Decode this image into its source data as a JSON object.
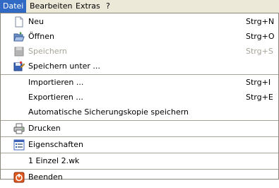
{
  "menubar": {
    "items": [
      {
        "label": "Datei"
      },
      {
        "label": "Bearbeiten"
      },
      {
        "label": "Extras"
      },
      {
        "label": "?"
      }
    ]
  },
  "menu": {
    "items": [
      {
        "label": "Neu",
        "shortcut": "Strg+N",
        "icon": "new-document-icon",
        "enabled": true
      },
      {
        "label": "Öffnen",
        "shortcut": "Strg+O",
        "icon": "open-folder-icon",
        "enabled": true
      },
      {
        "label": "Speichern",
        "shortcut": "Strg+S",
        "icon": "save-icon",
        "enabled": false
      },
      {
        "label": "Speichern unter ...",
        "shortcut": "",
        "icon": "save-as-icon",
        "enabled": true
      },
      {
        "label": "Importieren ...",
        "shortcut": "Strg+I",
        "enabled": true
      },
      {
        "label": "Exportieren ...",
        "shortcut": "Strg+E",
        "enabled": true
      },
      {
        "label": "Automatische Sicherungskopie speichern",
        "shortcut": "",
        "enabled": true
      },
      {
        "label": "Drucken",
        "shortcut": "",
        "icon": "printer-icon",
        "enabled": true
      },
      {
        "label": "Eigenschaften",
        "shortcut": "",
        "icon": "properties-icon",
        "enabled": true
      },
      {
        "label": "1 Einzel 2.wk",
        "shortcut": "",
        "enabled": true
      },
      {
        "label": "Beenden",
        "shortcut": "",
        "icon": "power-icon",
        "enabled": true
      }
    ]
  },
  "colors": {
    "menubar_bg": "#ece9d8",
    "active_menu_bg": "#316ac5",
    "disabled_text": "#a7a39a"
  }
}
